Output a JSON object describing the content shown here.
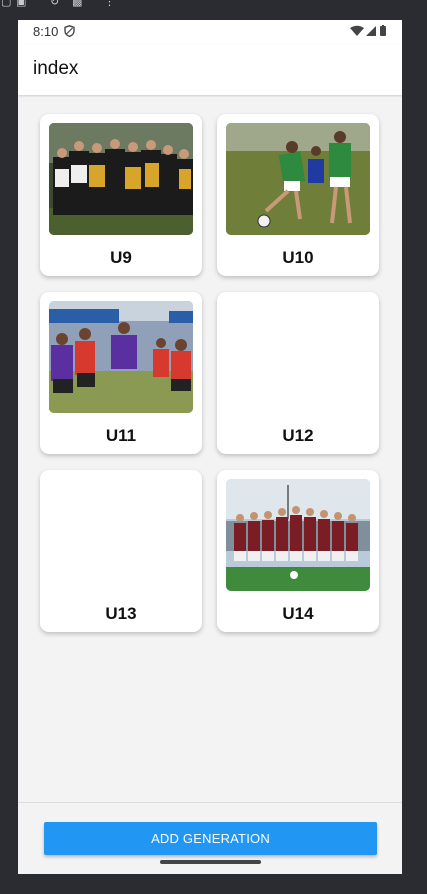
{
  "status_bar": {
    "time": "8:10"
  },
  "app_bar": {
    "title": "index"
  },
  "cards": [
    {
      "label": "U9",
      "has_image": true
    },
    {
      "label": "U10",
      "has_image": true
    },
    {
      "label": "U11",
      "has_image": true
    },
    {
      "label": "U12",
      "has_image": false
    },
    {
      "label": "U13",
      "has_image": false
    },
    {
      "label": "U14",
      "has_image": true
    }
  ],
  "add_button": {
    "label": "ADD GENERATION"
  },
  "colors": {
    "accent": "#2196f3",
    "background": "#f3f3f3",
    "card": "#ffffff"
  }
}
